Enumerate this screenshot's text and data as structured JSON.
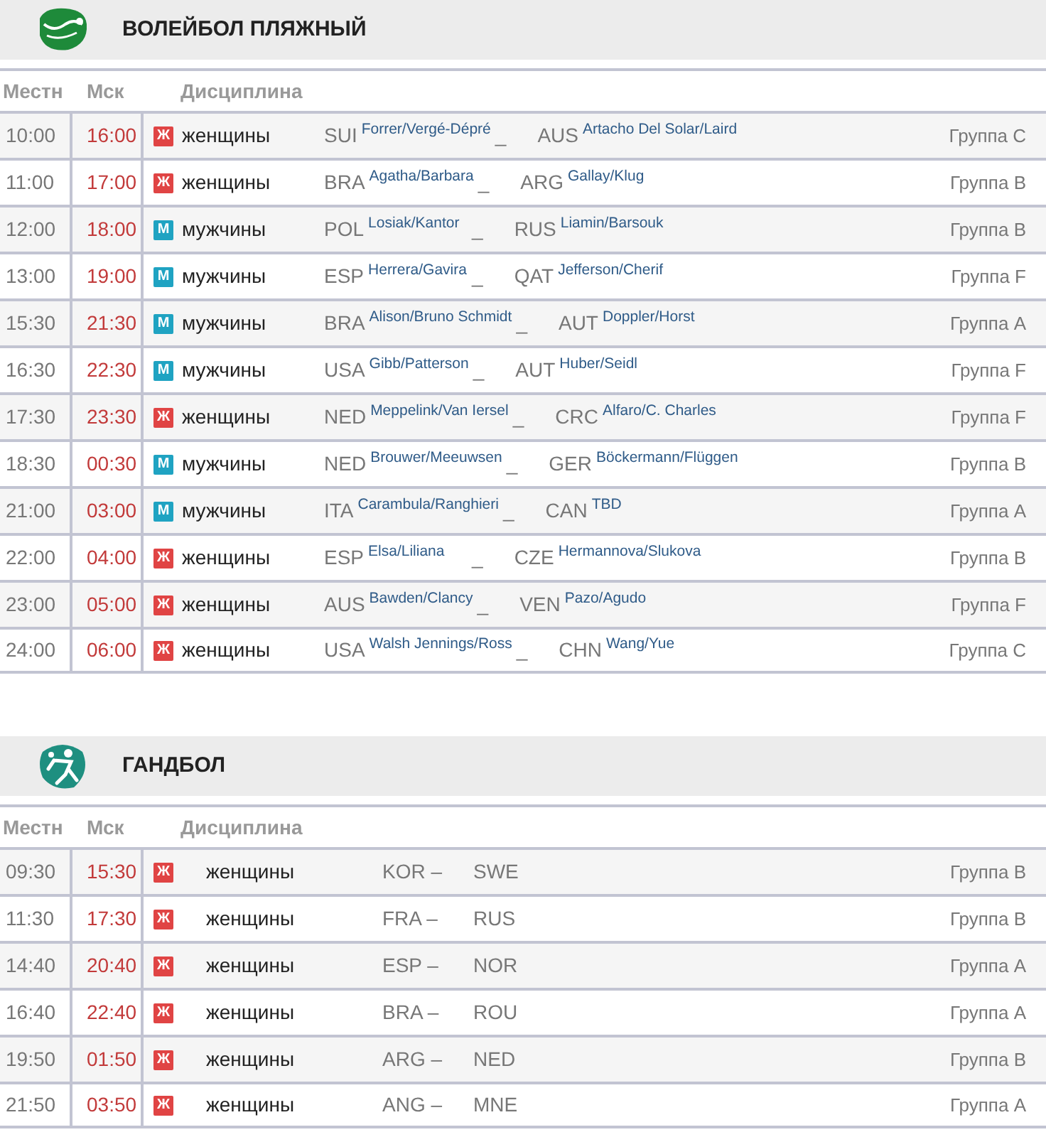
{
  "sections": [
    {
      "title": "ВОЛЕЙБОЛ ПЛЯЖНЫЙ",
      "kind": "beach",
      "columns": [
        "Местн",
        "Мск",
        "Дисциплина"
      ],
      "rows": [
        {
          "local": "10:00",
          "msk": "16:00",
          "kind": "women",
          "badge": "Ж",
          "discipline": "женщины",
          "team1": {
            "country": "SUI",
            "players": "Forrer/Vergé-Dépré"
          },
          "separator": "_",
          "team2": {
            "country": "AUS",
            "players": "Artacho Del Solar/Laird"
          },
          "group": "Группа C"
        },
        {
          "local": "11:00",
          "msk": "17:00",
          "kind": "women",
          "badge": "Ж",
          "discipline": "женщины",
          "team1": {
            "country": "BRA",
            "players": "Agatha/Barbara"
          },
          "separator": "_",
          "team2": {
            "country": "ARG",
            "players": "Gallay/Klug"
          },
          "group": "Группа B"
        },
        {
          "local": "12:00",
          "msk": "18:00",
          "kind": "men",
          "badge": "М",
          "discipline": "мужчины",
          "team1": {
            "country": "POL",
            "players": "Losiak/Kantor"
          },
          "separator": "_",
          "team2": {
            "country": "RUS",
            "players": "Liamin/Barsouk"
          },
          "group": "Группа B"
        },
        {
          "local": "13:00",
          "msk": "19:00",
          "kind": "men",
          "badge": "М",
          "discipline": "мужчины",
          "team1": {
            "country": "ESP",
            "players": "Herrera/Gavira"
          },
          "separator": "_",
          "team2": {
            "country": "QAT",
            "players": "Jefferson/Cherif"
          },
          "group": "Группа F"
        },
        {
          "local": "15:30",
          "msk": "21:30",
          "kind": "men",
          "badge": "М",
          "discipline": "мужчины",
          "team1": {
            "country": "BRA",
            "players": "Alison/Bruno Schmidt"
          },
          "separator": "_",
          "team2": {
            "country": "AUT",
            "players": "Doppler/Horst"
          },
          "group": "Группа A"
        },
        {
          "local": "16:30",
          "msk": "22:30",
          "kind": "men",
          "badge": "М",
          "discipline": "мужчины",
          "team1": {
            "country": "USA",
            "players": "Gibb/Patterson"
          },
          "separator": "_",
          "team2": {
            "country": "AUT",
            "players": "Huber/Seidl"
          },
          "group": "Группа F"
        },
        {
          "local": "17:30",
          "msk": "23:30",
          "kind": "women",
          "badge": "Ж",
          "discipline": "женщины",
          "team1": {
            "country": "NED",
            "players": "Meppelink/Van Iersel"
          },
          "separator": "_",
          "team2": {
            "country": "CRC",
            "players": "Alfaro/C. Charles"
          },
          "group": "Группа F"
        },
        {
          "local": "18:30",
          "msk": "00:30",
          "kind": "men",
          "badge": "М",
          "discipline": "мужчины",
          "team1": {
            "country": "NED",
            "players": "Brouwer/Meeuwsen"
          },
          "separator": "_",
          "team2": {
            "country": "GER",
            "players": "Böckermann/Flüggen"
          },
          "group": "Группа B"
        },
        {
          "local": "21:00",
          "msk": "03:00",
          "kind": "men",
          "badge": "М",
          "discipline": "мужчины",
          "team1": {
            "country": "ITA",
            "players": "Carambula/Ranghieri"
          },
          "separator": "_",
          "team2": {
            "country": "CAN",
            "players": "TBD"
          },
          "group": "Группа A"
        },
        {
          "local": "22:00",
          "msk": "04:00",
          "kind": "women",
          "badge": "Ж",
          "discipline": "женщины",
          "team1": {
            "country": "ESP",
            "players": "Elsa/Liliana"
          },
          "separator": "_",
          "team2": {
            "country": "CZE",
            "players": "Hermannova/Slukova"
          },
          "group": "Группа B"
        },
        {
          "local": "23:00",
          "msk": "05:00",
          "kind": "women",
          "badge": "Ж",
          "discipline": "женщины",
          "team1": {
            "country": "AUS",
            "players": "Bawden/Clancy"
          },
          "separator": "_",
          "team2": {
            "country": "VEN",
            "players": "Pazo/Agudo"
          },
          "group": "Группа F"
        },
        {
          "local": "24:00",
          "msk": "06:00",
          "kind": "women",
          "badge": "Ж",
          "discipline": "женщины",
          "team1": {
            "country": "USA",
            "players": "Walsh Jennings/Ross"
          },
          "separator": "_",
          "team2": {
            "country": "CHN",
            "players": "Wang/Yue"
          },
          "group": "Группа C"
        }
      ]
    },
    {
      "title": "ГАНДБОЛ",
      "kind": "handball",
      "columns": [
        "Местн",
        "Мск",
        "Дисциплина"
      ],
      "rows": [
        {
          "local": "09:30",
          "msk": "15:30",
          "kind": "women",
          "badge": "Ж",
          "discipline": "женщины",
          "team1": {
            "country": "KOR"
          },
          "separator": "–",
          "team2": {
            "country": "SWE"
          },
          "group": "Группа B"
        },
        {
          "local": "11:30",
          "msk": "17:30",
          "kind": "women",
          "badge": "Ж",
          "discipline": "женщины",
          "team1": {
            "country": "FRA"
          },
          "separator": "–",
          "team2": {
            "country": "RUS"
          },
          "group": "Группа B"
        },
        {
          "local": "14:40",
          "msk": "20:40",
          "kind": "women",
          "badge": "Ж",
          "discipline": "женщины",
          "team1": {
            "country": "ESP"
          },
          "separator": "–",
          "team2": {
            "country": "NOR"
          },
          "group": "Группа A"
        },
        {
          "local": "16:40",
          "msk": "22:40",
          "kind": "women",
          "badge": "Ж",
          "discipline": "женщины",
          "team1": {
            "country": "BRA"
          },
          "separator": "–",
          "team2": {
            "country": "ROU"
          },
          "group": "Группа A"
        },
        {
          "local": "19:50",
          "msk": "01:50",
          "kind": "women",
          "badge": "Ж",
          "discipline": "женщины",
          "team1": {
            "country": "ARG"
          },
          "separator": "–",
          "team2": {
            "country": "NED"
          },
          "group": "Группа B"
        },
        {
          "local": "21:50",
          "msk": "03:50",
          "kind": "women",
          "badge": "Ж",
          "discipline": "женщины",
          "team1": {
            "country": "ANG"
          },
          "separator": "–",
          "team2": {
            "country": "MNE"
          },
          "group": "Группа A"
        }
      ]
    }
  ]
}
